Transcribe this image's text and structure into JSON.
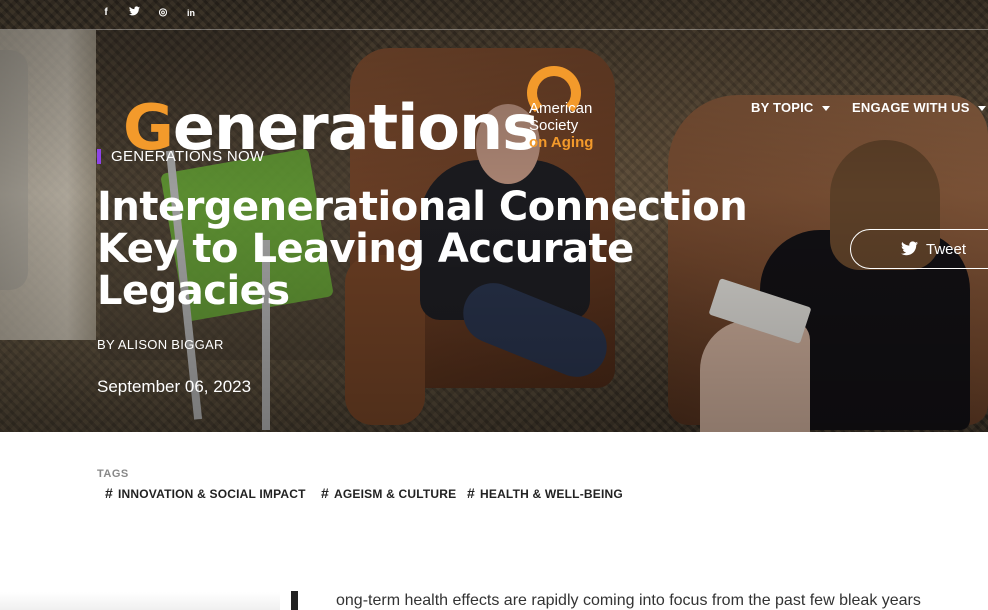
{
  "social": {
    "items": [
      {
        "name": "facebook",
        "glyph": "f"
      },
      {
        "name": "twitter",
        "glyph": "🐦"
      },
      {
        "name": "instagram",
        "glyph": "◎"
      },
      {
        "name": "linkedin",
        "glyph": "in"
      }
    ]
  },
  "logo": {
    "wordmark_first": "G",
    "wordmark_rest": "enerations",
    "org_line1": "American",
    "org_line2": "Society",
    "org_line3": "on Aging"
  },
  "nav": {
    "by_topic": "BY TOPIC",
    "engage": "ENGAGE WITH US"
  },
  "article": {
    "section": "GENERATIONS NOW",
    "title": "Intergenerational Connection Key to Leaving Accurate Legacies",
    "byline": "BY ALISON BIGGAR",
    "date": "September 06, 2023",
    "body_start": "ong-term health effects are rapidly coming into focus from the past few bleak years"
  },
  "share": {
    "tweet_label": "Tweet"
  },
  "tags": {
    "label": "TAGS",
    "items": [
      "INNOVATION & SOCIAL IMPACT",
      "AGEISM & CULTURE",
      "HEALTH & WELL-BEING"
    ]
  },
  "colors": {
    "brand_orange": "#f39a2b",
    "section_accent": "#8e44e8"
  }
}
